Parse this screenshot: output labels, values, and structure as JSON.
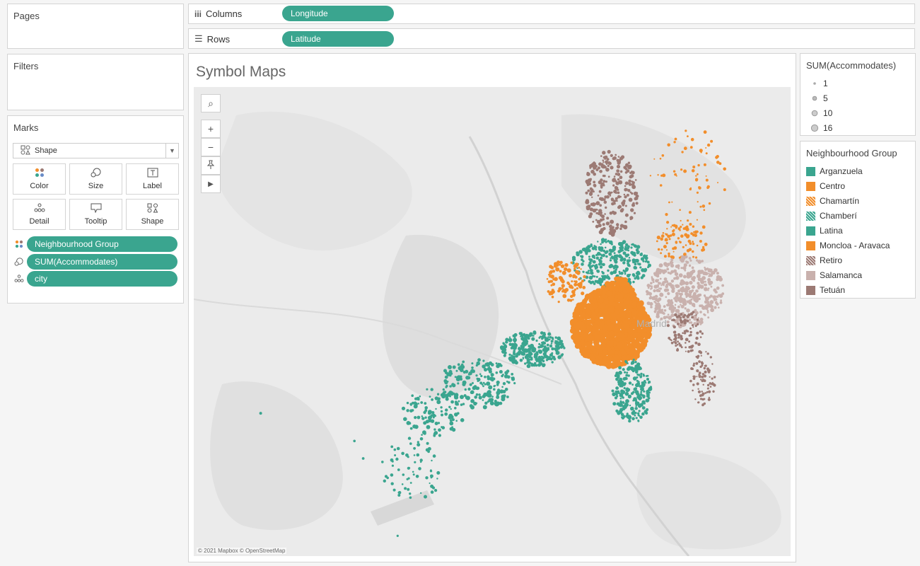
{
  "pages_card": {
    "title": "Pages"
  },
  "filters_card": {
    "title": "Filters"
  },
  "marks_card": {
    "title": "Marks",
    "mark_type": "Shape",
    "buttons": [
      {
        "label": "Color",
        "icon": "color-dots-icon"
      },
      {
        "label": "Size",
        "icon": "size-icon"
      },
      {
        "label": "Label",
        "icon": "label-icon"
      },
      {
        "label": "Detail",
        "icon": "detail-dots-icon"
      },
      {
        "label": "Tooltip",
        "icon": "tooltip-icon"
      },
      {
        "label": "Shape",
        "icon": "shape-icon"
      }
    ],
    "fields": [
      {
        "label": "Neighbourhood Group",
        "icon": "color-dots-icon"
      },
      {
        "label": "SUM(Accommodates)",
        "icon": "size-icon"
      },
      {
        "label": "city",
        "icon": "detail-dots-icon"
      }
    ]
  },
  "shelves": {
    "columns_label": "Columns",
    "columns_field": "Longitude",
    "rows_label": "Rows",
    "rows_field": "Latitude"
  },
  "view": {
    "title": "Symbol Maps",
    "map_label": "Madrid",
    "attribution": "© 2021 Mapbox © OpenStreetMap"
  },
  "size_legend": {
    "title": "SUM(Accommodates)",
    "items": [
      "1",
      "5",
      "10",
      "16"
    ]
  },
  "color_legend": {
    "title": "Neighbourhood Group",
    "items": [
      {
        "label": "Arganzuela",
        "color": "#3aa58f",
        "pattern": "solid"
      },
      {
        "label": "Centro",
        "color": "#f28e2b",
        "pattern": "solid"
      },
      {
        "label": "Chamartín",
        "color": "#f28e2b",
        "pattern": "hatched"
      },
      {
        "label": "Chamberí",
        "color": "#3aa58f",
        "pattern": "hatched"
      },
      {
        "label": "Latina",
        "color": "#3aa58f",
        "pattern": "solid"
      },
      {
        "label": "Moncloa - Aravaca",
        "color": "#f28e2b",
        "pattern": "solid"
      },
      {
        "label": "Retiro",
        "color": "#9c7a74",
        "pattern": "hatched"
      },
      {
        "label": "Salamanca",
        "color": "#c9b1ad",
        "pattern": "solid"
      },
      {
        "label": "Tetuán",
        "color": "#9c7a74",
        "pattern": "solid"
      }
    ]
  },
  "colors": {
    "teal": "#3aa58f",
    "orange": "#f28e2b",
    "brown": "#9c7a74",
    "rose": "#c9b1ad"
  }
}
